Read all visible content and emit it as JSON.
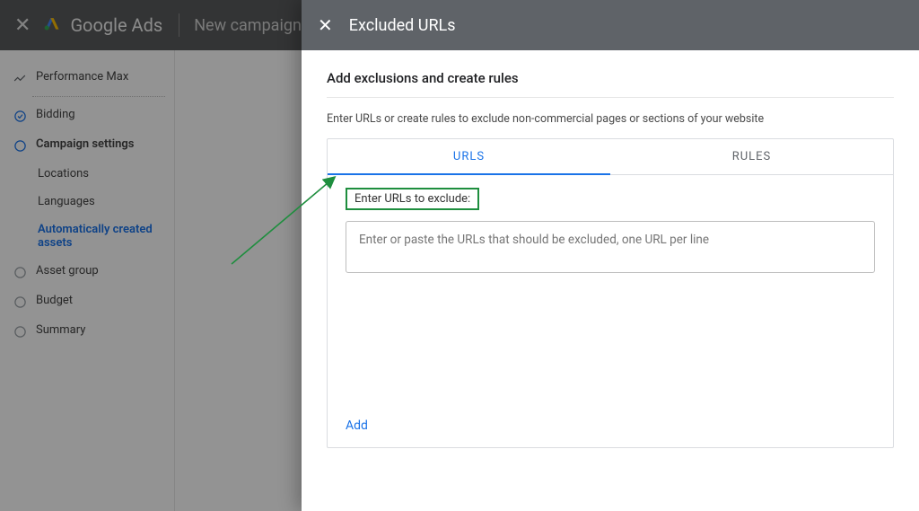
{
  "header": {
    "product": "Google Ads",
    "breadcrumb": "New campaign"
  },
  "sidebar": {
    "items": [
      {
        "label": "Performance Max",
        "type": "trend"
      },
      {
        "label": "Bidding",
        "type": "check"
      },
      {
        "label": "Campaign settings",
        "type": "active"
      },
      {
        "label": "Locations",
        "type": "sub"
      },
      {
        "label": "Languages",
        "type": "sub"
      },
      {
        "label": "Automatically created assets",
        "type": "sub-blue"
      },
      {
        "label": "Asset group",
        "type": "open"
      },
      {
        "label": "Budget",
        "type": "open"
      },
      {
        "label": "Summary",
        "type": "open"
      }
    ]
  },
  "panel": {
    "title": "Excluded URLs",
    "subtitle": "Add exclusions and create rules",
    "description": "Enter URLs or create rules to exclude non-commercial pages or sections of your website",
    "tabs": {
      "urls": "URLS",
      "rules": "RULES"
    },
    "field_label": "Enter URLs to exclude:",
    "placeholder": "Enter or paste the URLs that should be excluded, one URL per line",
    "add_label": "Add"
  }
}
